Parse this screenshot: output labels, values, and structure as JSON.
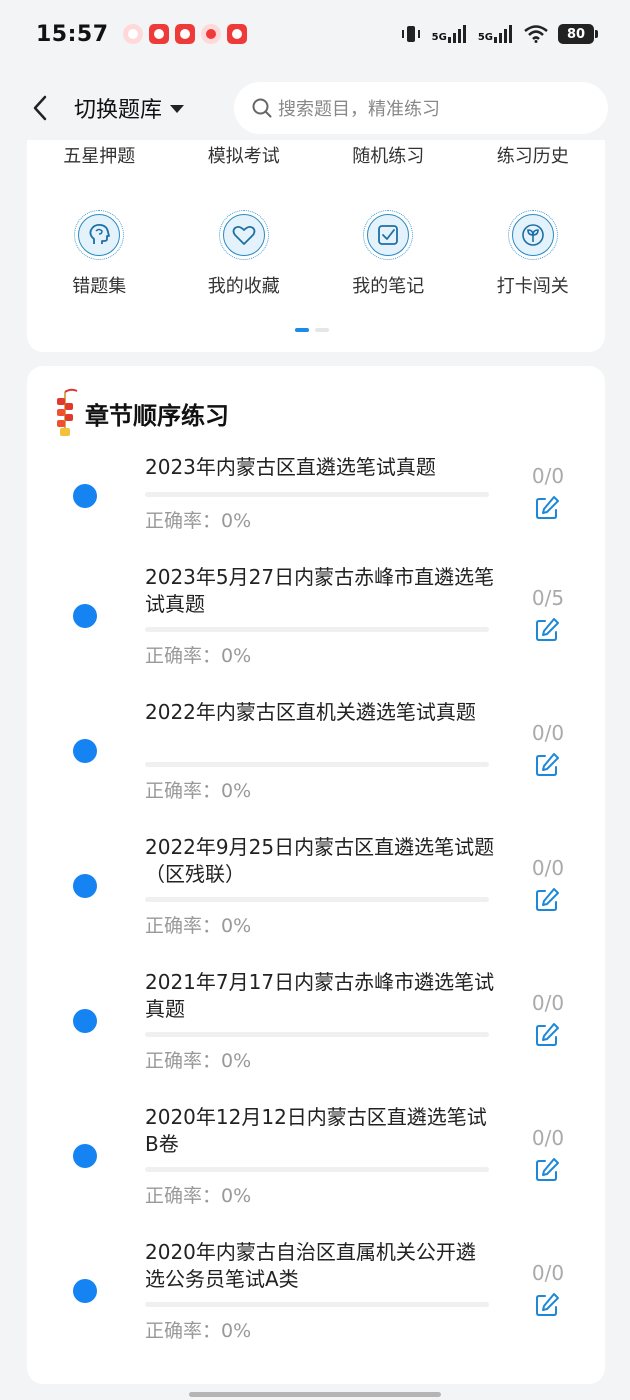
{
  "status_bar": {
    "time": "15:57",
    "battery": "80",
    "signal_labels": [
      "5G",
      "5G"
    ],
    "icons": [
      "vibrate-icon",
      "signal-icon",
      "signal-icon",
      "wifi-icon",
      "battery-icon"
    ]
  },
  "header": {
    "back_icon": "chevron-left-icon",
    "bank_switch_label": "切换题库",
    "search_placeholder": "搜索题目，精准练习"
  },
  "top_menu": {
    "row1": [
      "五星押题",
      "模拟考试",
      "随机练习",
      "练习历史"
    ],
    "row2": [
      {
        "label": "错题集",
        "icon": "head-icon"
      },
      {
        "label": "我的收藏",
        "icon": "heart-icon"
      },
      {
        "label": "我的笔记",
        "icon": "note-check-icon"
      },
      {
        "label": "打卡闯关",
        "icon": "sprout-icon"
      }
    ]
  },
  "chapter": {
    "title": "章节顺序练习",
    "icon": "firecracker-icon",
    "accent": "#1583f2",
    "items": [
      {
        "title": "2023年内蒙古区直遴选笔试真题",
        "rate": "正确率：0%",
        "count": "0/0"
      },
      {
        "title": "2023年5月27日内蒙古赤峰市直遴选笔试真题",
        "rate": "正确率：0%",
        "count": "0/5"
      },
      {
        "title": "2022年内蒙古区直机关遴选笔试真题",
        "rate": "正确率：0%",
        "count": "0/0"
      },
      {
        "title": "2022年9月25日内蒙古区直遴选笔试题（区残联）",
        "rate": "正确率：0%",
        "count": "0/0"
      },
      {
        "title": "2021年7月17日内蒙古赤峰市遴选笔试真题",
        "rate": "正确率：0%",
        "count": "0/0"
      },
      {
        "title": "2020年12月12日内蒙古区直遴选笔试B卷",
        "rate": "正确率：0%",
        "count": "0/0"
      },
      {
        "title": "2020年内蒙古自治区直属机关公开遴选公务员笔试A类",
        "rate": "正确率：0%",
        "count": "0/0"
      }
    ]
  }
}
